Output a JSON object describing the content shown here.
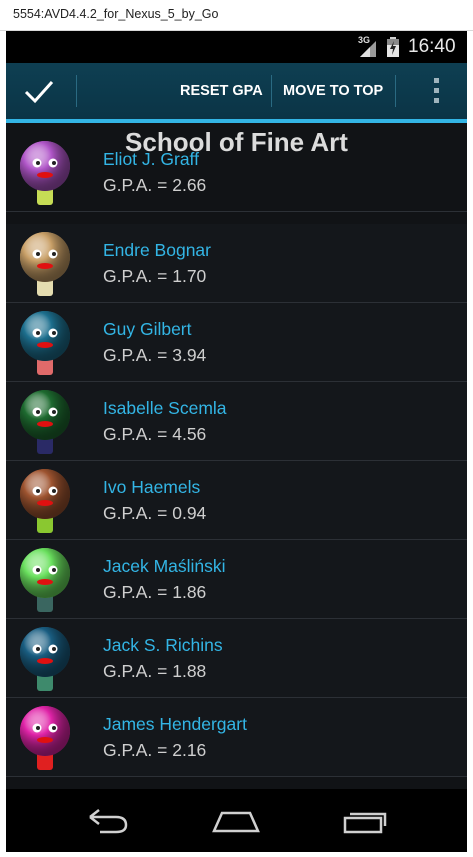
{
  "window": {
    "title": "5554:AVD4.4.2_for_Nexus_5_by_Go"
  },
  "status_bar": {
    "network": "3G",
    "time": "16:40"
  },
  "action_bar": {
    "done_icon": "checkmark-icon",
    "reset_label": "RESET GPA",
    "move_label": "MOVE TO TOP",
    "overflow_icon": "overflow-menu-icon",
    "accent": "#33b5e5"
  },
  "page": {
    "title": "School of Fine Art"
  },
  "students": [
    {
      "name": "Eliot J. Graff",
      "gpa": "G.P.A. = 2.66",
      "head_color": "#b056c8",
      "neck_color": "#c6dc55"
    },
    {
      "name": "Endre Bognar",
      "gpa": "G.P.A. = 1.70",
      "head_color": "#c9a068",
      "neck_color": "#e4dcb0"
    },
    {
      "name": "Guy Gilbert",
      "gpa": "G.P.A. = 3.94",
      "head_color": "#1d6f8e",
      "neck_color": "#e06a6a"
    },
    {
      "name": "Isabelle Scemla",
      "gpa": "G.P.A. = 4.56",
      "head_color": "#1e6b30",
      "neck_color": "#2a2a66"
    },
    {
      "name": "Ivo Haemels",
      "gpa": "G.P.A. = 0.94",
      "head_color": "#9e5430",
      "neck_color": "#8ac830"
    },
    {
      "name": "Jacek Maśliński",
      "gpa": "G.P.A. = 1.86",
      "head_color": "#6ae05e",
      "neck_color": "#3a6660"
    },
    {
      "name": "Jack S. Richins",
      "gpa": "G.P.A. = 1.88",
      "head_color": "#1a5e82",
      "neck_color": "#3e8a6c"
    },
    {
      "name": "James Hendergart",
      "gpa": "G.P.A. = 2.16",
      "head_color": "#e024a8",
      "neck_color": "#e02020"
    }
  ],
  "nav_bar": {
    "back_icon": "back-icon",
    "home_icon": "home-icon",
    "recents_icon": "recent-apps-icon"
  }
}
